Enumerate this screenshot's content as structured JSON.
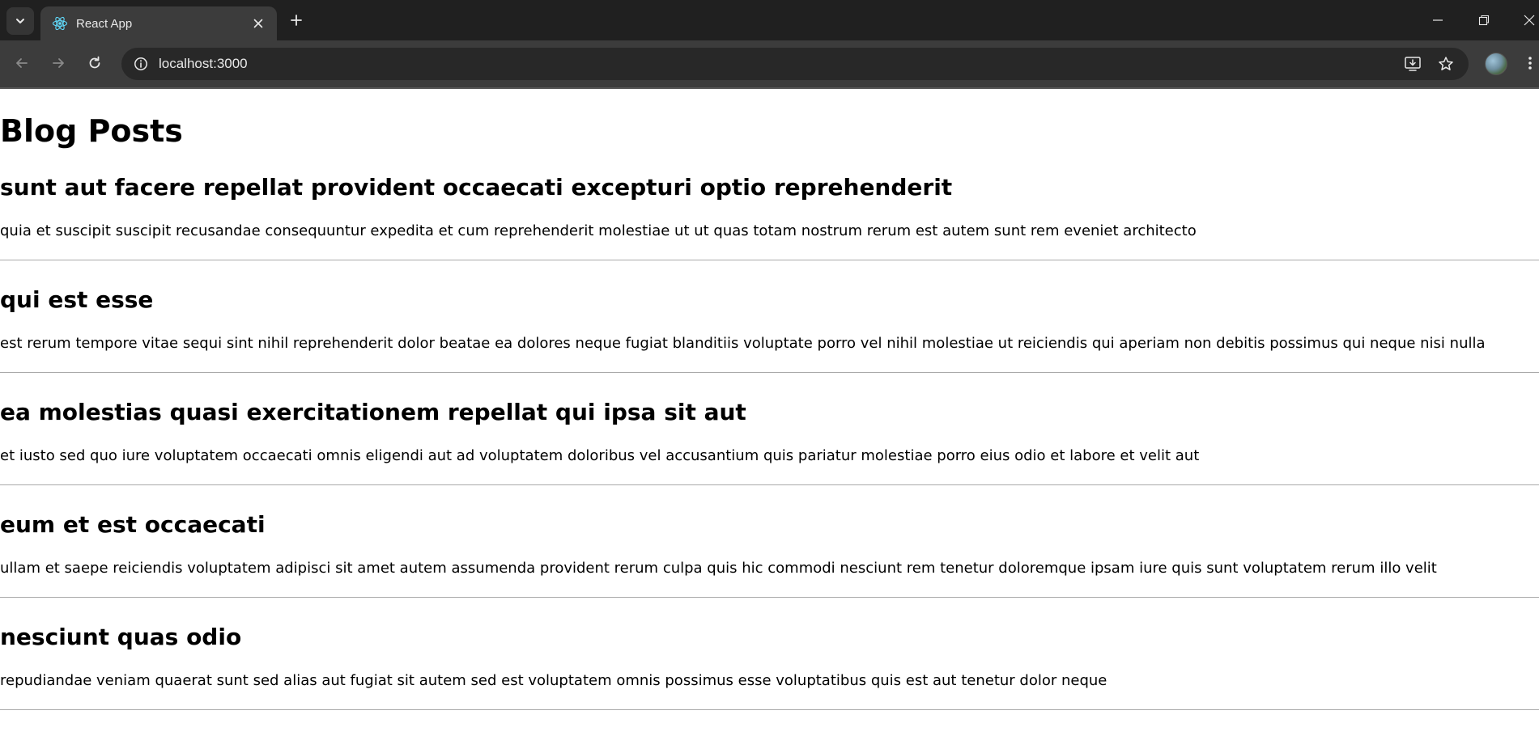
{
  "browser": {
    "tab_title": "React App",
    "url": "localhost:3000",
    "icons": {
      "tab_search": "chevron-down-icon",
      "favicon": "react-icon",
      "tab_close": "close-icon",
      "new_tab": "plus-icon",
      "back": "arrow-left-icon",
      "forward": "arrow-right-icon",
      "reload": "reload-icon",
      "site_info": "info-icon",
      "install": "install-app-icon",
      "bookmark": "star-icon",
      "menu": "kebab-menu-icon",
      "minimize": "minimize-icon",
      "restore": "restore-icon",
      "close_window": "close-icon"
    }
  },
  "page": {
    "title": "Blog Posts",
    "posts": [
      {
        "title": "sunt aut facere repellat provident occaecati excepturi optio reprehenderit",
        "body": "quia et suscipit suscipit recusandae consequuntur expedita et cum reprehenderit molestiae ut ut quas totam nostrum rerum est autem sunt rem eveniet architecto"
      },
      {
        "title": "qui est esse",
        "body": "est rerum tempore vitae sequi sint nihil reprehenderit dolor beatae ea dolores neque fugiat blanditiis voluptate porro vel nihil molestiae ut reiciendis qui aperiam non debitis possimus qui neque nisi nulla"
      },
      {
        "title": "ea molestias quasi exercitationem repellat qui ipsa sit aut",
        "body": "et iusto sed quo iure voluptatem occaecati omnis eligendi aut ad voluptatem doloribus vel accusantium quis pariatur molestiae porro eius odio et labore et velit aut"
      },
      {
        "title": "eum et est occaecati",
        "body": "ullam et saepe reiciendis voluptatem adipisci sit amet autem assumenda provident rerum culpa quis hic commodi nesciunt rem tenetur doloremque ipsam iure quis sunt voluptatem rerum illo velit"
      },
      {
        "title": "nesciunt quas odio",
        "body": "repudiandae veniam quaerat sunt sed alias aut fugiat sit autem sed est voluptatem omnis possimus esse voluptatibus quis est aut tenetur dolor neque"
      }
    ]
  }
}
